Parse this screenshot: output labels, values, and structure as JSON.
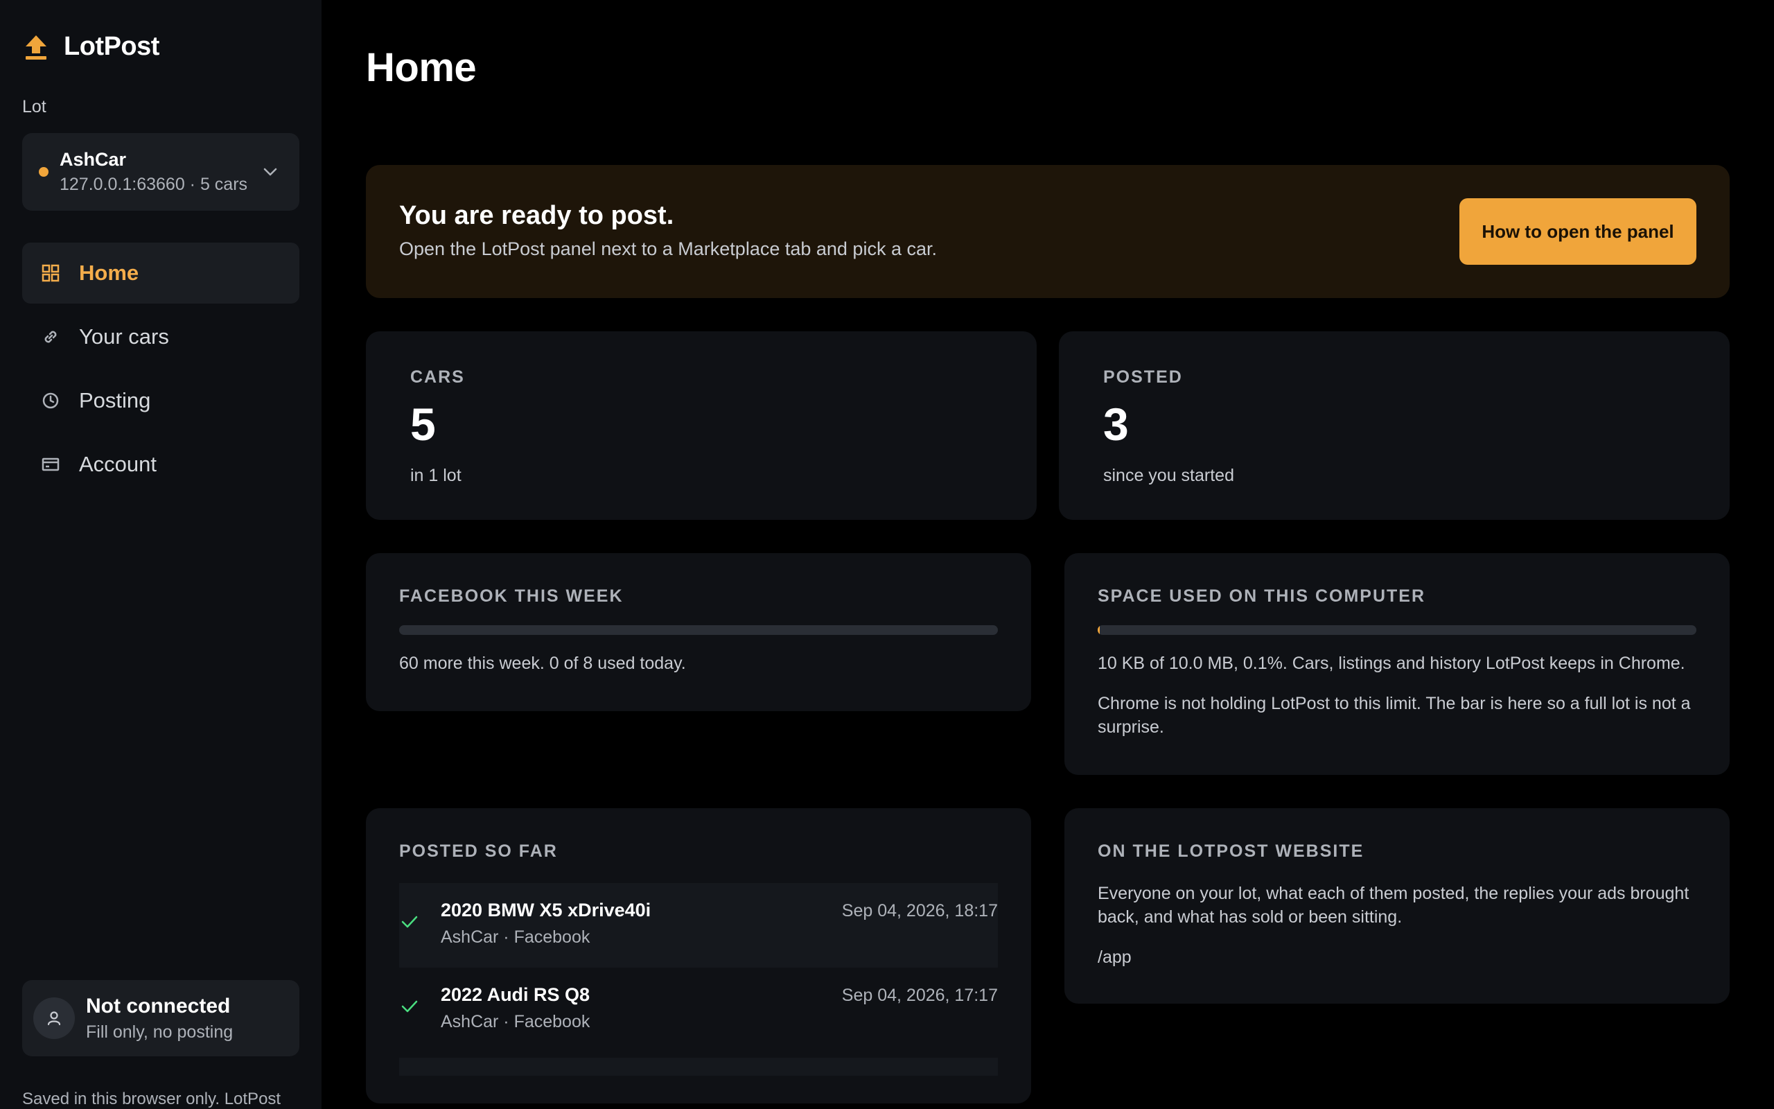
{
  "app": {
    "name": "LotPost"
  },
  "sidebar": {
    "lot_label": "Lot",
    "lot": {
      "name": "AshCar",
      "meta": "127.0.0.1:63660 · 5 cars",
      "status_color": "#f0a53b"
    },
    "nav": [
      {
        "label": "Home",
        "icon": "grid-icon",
        "active": true
      },
      {
        "label": "Your cars",
        "icon": "link-icon",
        "active": false
      },
      {
        "label": "Posting",
        "icon": "clock-icon",
        "active": false
      },
      {
        "label": "Account",
        "icon": "card-icon",
        "active": false
      }
    ],
    "connection": {
      "title": "Not connected",
      "subtitle": "Fill only, no posting"
    },
    "saved_note": "Saved in this browser only. LotPost"
  },
  "main": {
    "title": "Home",
    "banner": {
      "title": "You are ready to post.",
      "subtitle": "Open the LotPost panel next to a Marketplace tab and pick a car.",
      "button": "How to open the panel"
    },
    "stats": [
      {
        "label": "CARS",
        "value": "5",
        "sub": "in 1 lot"
      },
      {
        "label": "POSTED",
        "value": "3",
        "sub": "since you started"
      }
    ],
    "facebook": {
      "label": "FACEBOOK THIS WEEK",
      "progress": 0,
      "text": "60 more this week. 0 of 8 used today."
    },
    "space": {
      "label": "SPACE USED ON THIS COMPUTER",
      "progress": 0.001,
      "text": "10 KB of 10.0 MB, 0.1%. Cars, listings and history LotPost keeps in Chrome.",
      "note": "Chrome is not holding LotPost to this limit. The bar is here so a full lot is not a surprise."
    },
    "posted": {
      "label": "POSTED SO FAR",
      "items": [
        {
          "title": "2020 BMW X5 xDrive40i",
          "meta": "AshCar · Facebook",
          "time": "Sep 04, 2026, 18:17"
        },
        {
          "title": "2022 Audi RS Q8",
          "meta": "AshCar · Facebook",
          "time": "Sep 04, 2026, 17:17"
        }
      ]
    },
    "website": {
      "label": "ON THE LOTPOST WEBSITE",
      "text": "Everyone on your lot, what each of them posted, the replies your ads brought back, and what has sold or been sitting.",
      "path": "/app"
    }
  },
  "colors": {
    "accent": "#f0a53b",
    "check": "#4ade80"
  }
}
